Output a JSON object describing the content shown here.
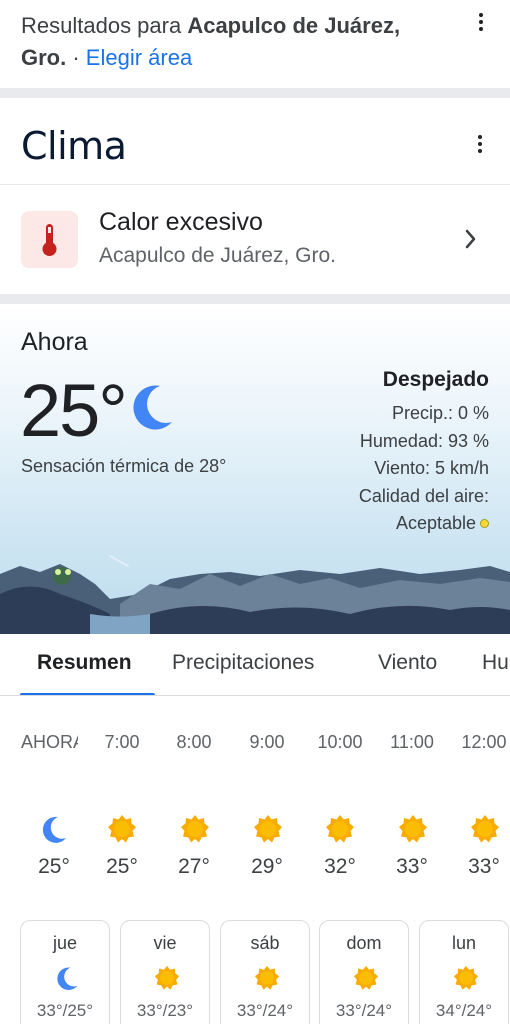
{
  "results": {
    "prefix": "Resultados para ",
    "location_bold": "Acapulco de Juárez, Gro.",
    "separator": " · ",
    "change_area_link": "Elegir área"
  },
  "clima": {
    "title": "Clima"
  },
  "alert": {
    "title": "Calor excesivo",
    "location": "Acapulco de Juárez, Gro.",
    "icon": "thermometer-icon"
  },
  "now": {
    "label": "Ahora",
    "temperature": "25°",
    "condition_icon": "moon-icon",
    "feels_like": "Sensación térmica de 28°",
    "condition": "Despejado",
    "precip": "Precip.: 0 %",
    "humidity": "Humedad: 93 %",
    "wind": "Viento: 5 km/h",
    "air_quality_label": "Calidad del aire:",
    "air_quality_value": "Aceptable",
    "air_quality_color": "#fdd835"
  },
  "tabs": [
    {
      "label": "Resumen",
      "active": true
    },
    {
      "label": "Precipitaciones",
      "active": false
    },
    {
      "label": "Viento",
      "active": false
    },
    {
      "label": "Humedad",
      "active": false
    }
  ],
  "hourly": [
    {
      "time": "AHORA",
      "icon": "moon-icon",
      "temp": "25°"
    },
    {
      "time": "7:00",
      "icon": "sun-icon",
      "temp": "25°"
    },
    {
      "time": "8:00",
      "icon": "sun-icon",
      "temp": "27°"
    },
    {
      "time": "9:00",
      "icon": "sun-icon",
      "temp": "29°"
    },
    {
      "time": "10:00",
      "icon": "sun-icon",
      "temp": "32°"
    },
    {
      "time": "11:00",
      "icon": "sun-icon",
      "temp": "33°"
    },
    {
      "time": "12:00",
      "icon": "sun-icon",
      "temp": "33°"
    }
  ],
  "daily": [
    {
      "day": "jue",
      "icon": "moon-icon",
      "temps": "33°/25°"
    },
    {
      "day": "vie",
      "icon": "sun-icon",
      "temps": "33°/23°"
    },
    {
      "day": "sáb",
      "icon": "sun-icon",
      "temps": "33°/24°"
    },
    {
      "day": "dom",
      "icon": "sun-icon",
      "temps": "33°/24°"
    },
    {
      "day": "lun",
      "icon": "sun-icon",
      "temps": "34°/24°"
    }
  ],
  "colors": {
    "accent": "#1a73e8",
    "sun": "#f9ab00",
    "moon": "#4285f4",
    "alert_bg": "#fce8e6",
    "alert_icon": "#c5221f"
  }
}
